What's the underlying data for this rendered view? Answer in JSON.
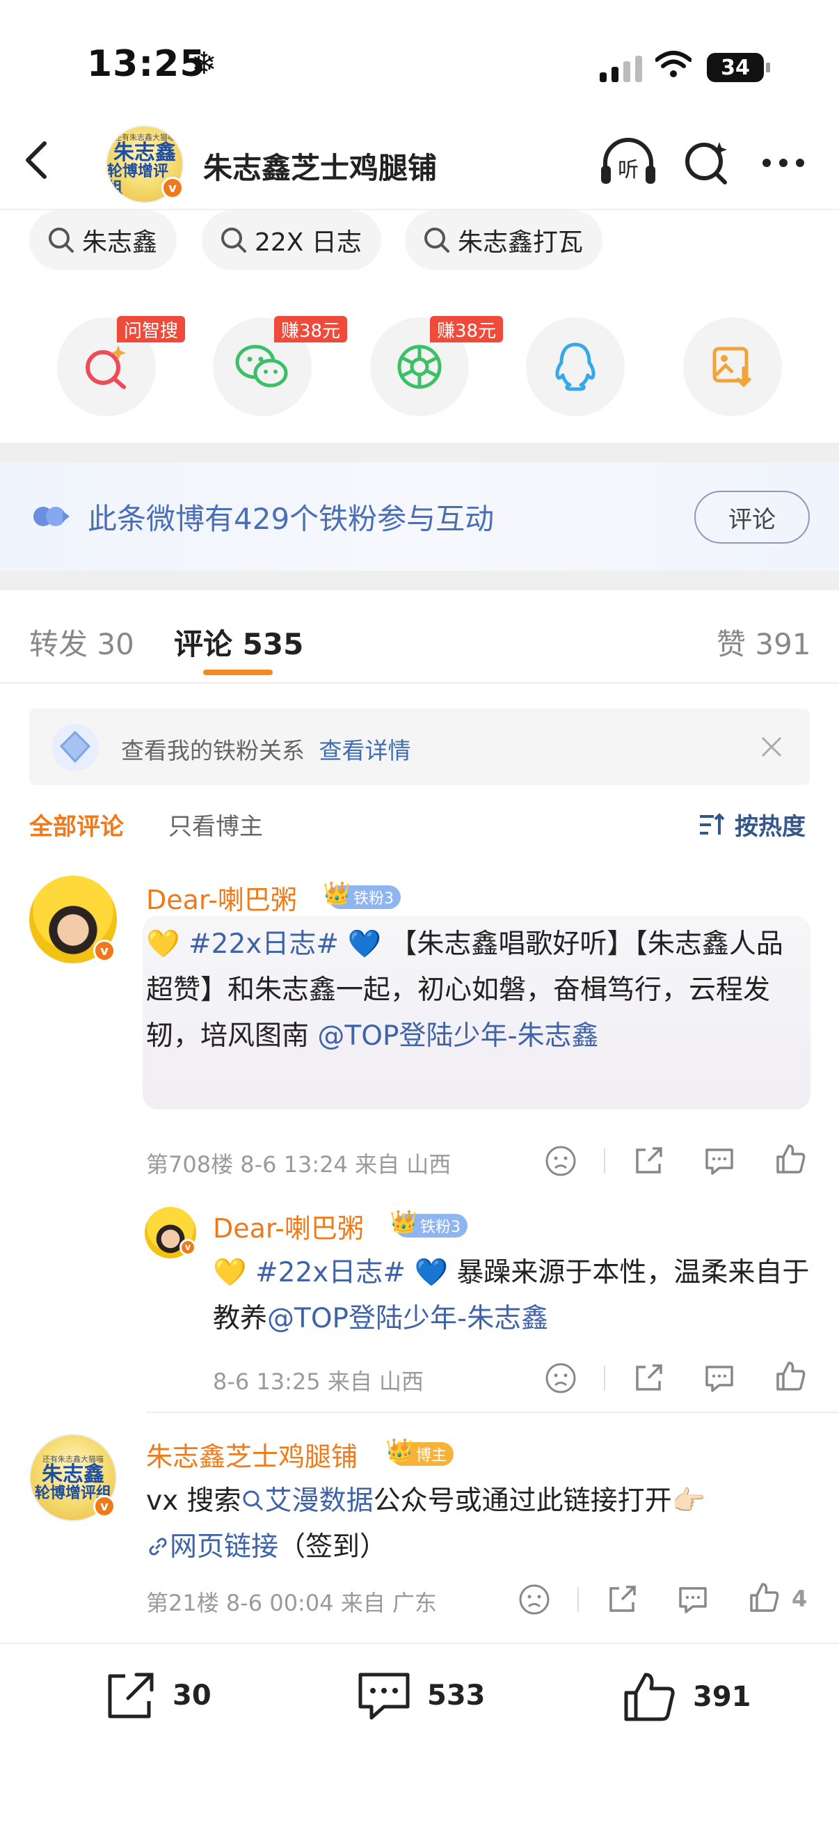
{
  "status": {
    "time": "13:25",
    "battery": "34"
  },
  "header": {
    "title": "朱志鑫芝士鸡腿铺",
    "avatar_text": {
      "top": "还有朱志鑫大猫喵",
      "line1": "朱志鑫",
      "line2": "轮博增评组"
    }
  },
  "search_chips": [
    "朱志鑫",
    "22X 日志",
    "朱志鑫打瓦"
  ],
  "share": {
    "tags": [
      "问智搜",
      "赚38元",
      "赚38元"
    ]
  },
  "fans_banner": {
    "text": "此条微博有429个铁粉参与互动",
    "button": "评论"
  },
  "tabs": {
    "repost": "转发 30",
    "comment": "评论 535",
    "like": "赞 391"
  },
  "notice": {
    "text": "查看我的铁粉关系",
    "link": "查看详情"
  },
  "filters": {
    "all": "全部评论",
    "host_only": "只看博主",
    "sort": "按热度"
  },
  "comments": [
    {
      "user": "Dear-喇巴粥",
      "badge": "铁粉3",
      "emoji_start": "💛",
      "hashtag": "#22x日志#",
      "emoji_end": "💙",
      "text": "【朱志鑫唱歌好听】【朱志鑫人品超赞】和朱志鑫一起，初心如磐，奋楫笃行，云程发轫，培风图南",
      "at": "@TOP登陆少年-朱志鑫",
      "meta": "第708楼  8-6 13:24  来自 山西"
    },
    {
      "user": "Dear-喇巴粥",
      "badge": "铁粉3",
      "emoji_start": "💛",
      "hashtag": "#22x日志#",
      "emoji_end": "💙",
      "text": "暴躁来源于本性，温柔来自于教养",
      "at": "@TOP登陆少年-朱志鑫",
      "meta": "8-6 13:25  来自 山西"
    },
    {
      "user": "朱志鑫芝士鸡腿铺",
      "badge": "博主",
      "text_pre": "vx 搜索",
      "search_word": "艾漫数据",
      "text_mid": "公众号或通过此链接打开",
      "link_text": "网页链接",
      "text_end": "（签到）",
      "meta": "第21楼  8-6 00:04  来自 广东",
      "likes": "4"
    }
  ],
  "bottom": {
    "repost": "30",
    "comment": "533",
    "like": "391"
  },
  "colors": {
    "accent": "#f28a22",
    "link": "#3f63a8",
    "username": "#ef7a1a"
  }
}
